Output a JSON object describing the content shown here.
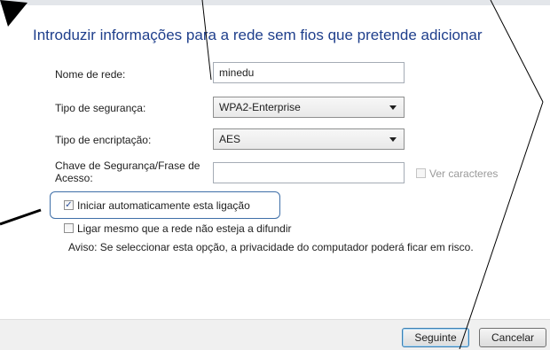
{
  "dialog": {
    "title": "Introduzir informações para a rede sem fios que pretende adicionar"
  },
  "form": {
    "network_name": {
      "label": "Nome de rede:",
      "value": "minedu"
    },
    "security_type": {
      "label": "Tipo de segurança:",
      "value": "WPA2-Enterprise"
    },
    "encryption_type": {
      "label": "Tipo de encriptação:",
      "value": "AES"
    },
    "security_key": {
      "label": "Chave de Segurança/Frase de Acesso:",
      "value": ""
    },
    "show_characters": {
      "label": "Ver caracteres",
      "checked": false,
      "enabled": false
    },
    "auto_connect": {
      "label": "Iniciar automaticamente esta ligação",
      "checked": true
    },
    "connect_hidden": {
      "label": "Ligar mesmo que a rede não esteja a difundir",
      "checked": false
    },
    "warning": "Aviso: Se seleccionar esta opção, a privacidade do computador poderá ficar em risco."
  },
  "buttons": {
    "next": "Seguinte",
    "cancel": "Cancelar"
  },
  "colors": {
    "title": "#1f3f8c",
    "highlight": "#3f6fa8"
  }
}
